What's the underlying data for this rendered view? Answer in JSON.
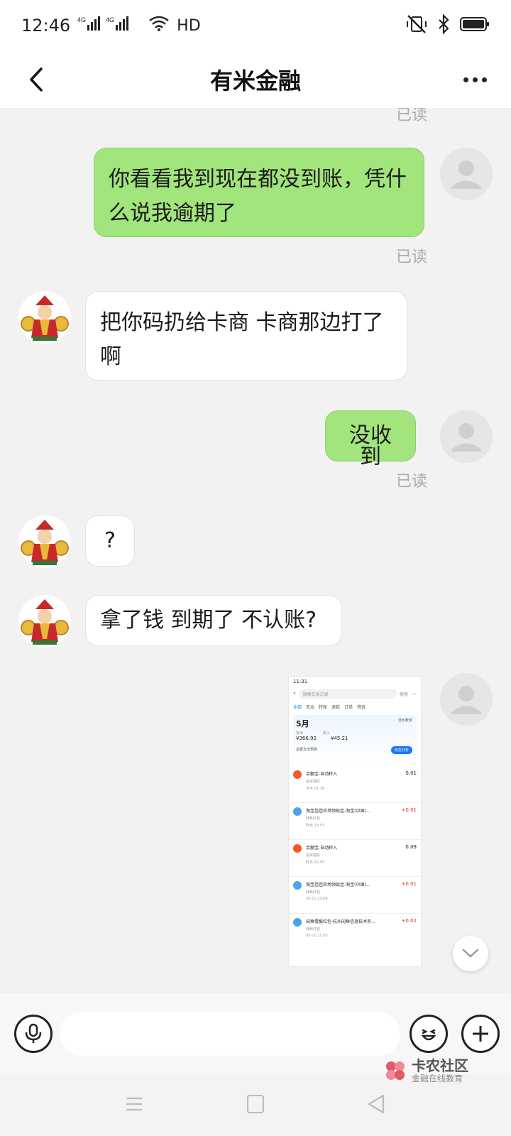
{
  "status_bar": {
    "time": "12:46",
    "network": "4G 4G",
    "hd": "HD"
  },
  "header": {
    "title": "有米金融",
    "back_icon": "chevron-left-icon",
    "more_icon": "more-dots-icon"
  },
  "messages": [
    {
      "side": "me",
      "read_label": "已读",
      "partial": true
    },
    {
      "side": "me",
      "text": "你看看我到现在都没到账，凭什么说我逾期了",
      "read_label": "已读"
    },
    {
      "side": "them",
      "text": "把你码扔给卡商 卡商那边打了啊"
    },
    {
      "side": "me",
      "text": "没收到",
      "read_label": "已读"
    },
    {
      "side": "them",
      "text": "?"
    },
    {
      "side": "them",
      "text": "拿了钱 到期了 不认账?"
    },
    {
      "side": "me",
      "type": "image"
    }
  ],
  "embedded_screenshot": {
    "time": "11:31",
    "search_placeholder": "搜索交易记录",
    "search_button": "搜索",
    "tabs": [
      "全部",
      "支出",
      "转账",
      "退款",
      "订单",
      "筛选"
    ],
    "month": "5月",
    "expense_label": "支出",
    "expense_value": "¥366.92",
    "income_label": "收入",
    "income_value": "¥45.21",
    "budget_link": "设置支出预算",
    "analysis_button": "收支分析",
    "bill_link": "流水账单",
    "records": [
      {
        "title": "余额宝-自动转入",
        "sub": "投资理财",
        "time": "今天 01:16",
        "amount": "0.01",
        "icon": "alipay-yuebao-icon"
      },
      {
        "title": "淘宝芭芭农场领现金-淘宝(中国)...",
        "sub": "转账红包",
        "time": "昨天 23:57",
        "amount": "+0.01",
        "icon": "user-avatar-icon"
      },
      {
        "title": "余额宝-自动转入",
        "sub": "投资理财",
        "time": "昨天 00:55",
        "amount": "0.09",
        "icon": "alipay-yuebao-icon"
      },
      {
        "title": "淘宝芭芭农场领现金-淘宝(中国)...",
        "sub": "转账红包",
        "time": "05-21 22:09",
        "amount": "+0.01",
        "icon": "user-avatar-icon"
      },
      {
        "title": "闲鱼情报红包-杭州闲鱼信息技术有...",
        "sub": "转账红包",
        "time": "05-21 21:09",
        "amount": "+0.02",
        "icon": "user-avatar-icon"
      }
    ]
  },
  "input_bar": {
    "placeholder": "",
    "mic_icon": "microphone-icon",
    "emoji_icon": "emoji-icon",
    "plus_icon": "plus-icon"
  },
  "watermark": {
    "title": "卡农社区",
    "subtitle": "金融在线教育"
  },
  "colors": {
    "my_bubble": "#a3e57d",
    "their_bubble": "#ffffff",
    "background": "#f2f2f2",
    "read_text": "#aaaaaa"
  }
}
